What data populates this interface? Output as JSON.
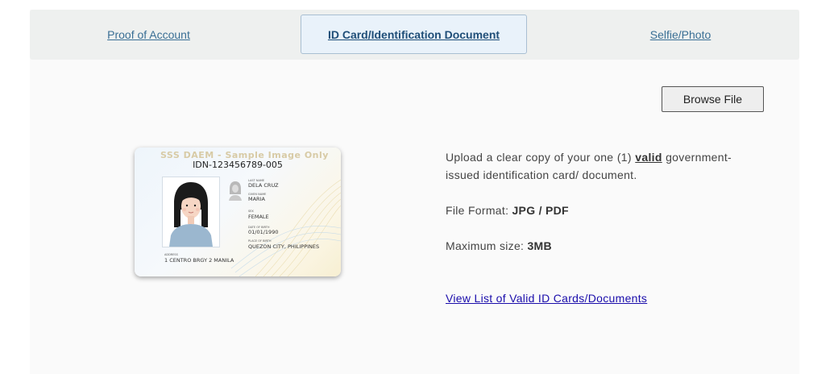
{
  "tabs": [
    {
      "label": "Proof of Account",
      "active": false
    },
    {
      "label": "ID Card/Identification Document",
      "active": true
    },
    {
      "label": "Selfie/Photo",
      "active": false
    }
  ],
  "browse_button": "Browse File",
  "sample_card": {
    "watermark": "SSS DAEM - Sample Image Only",
    "id_number": "IDN-123456789-005",
    "fields": [
      {
        "label": "Last Name",
        "value": "DELA CRUZ"
      },
      {
        "label": "Given Name",
        "value": "MARIA"
      },
      {
        "label": "Sex",
        "value": "FEMALE"
      },
      {
        "label": "Date of Birth",
        "value": "01/01/1990"
      },
      {
        "label": "Place of Birth",
        "value": "QUEZON CITY, PHILIPPINES"
      }
    ],
    "address_label": "Address",
    "address_value": "1 CENTRO BRGY 2 MANILA"
  },
  "instructions": {
    "line_prefix": "Upload a clear copy of your one (1) ",
    "line_emph": "valid",
    "line_suffix": " government-issued identification card/ document.",
    "format_label": "File Format: ",
    "format_value": "JPG / PDF",
    "size_label": "Maximum size: ",
    "size_value": "3MB"
  },
  "view_list_link": "View List of Valid ID Cards/Documents"
}
